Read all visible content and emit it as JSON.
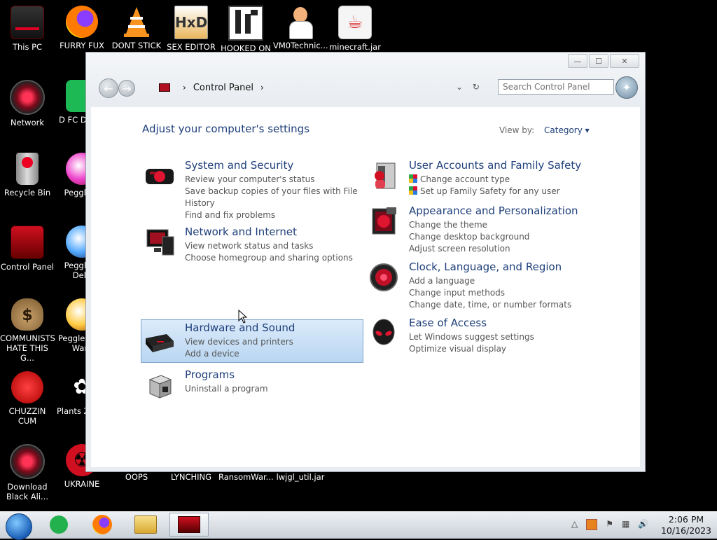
{
  "desktop": {
    "icons": [
      {
        "label": "This PC"
      },
      {
        "label": "FURRY FUX"
      },
      {
        "label": "DONT STICK"
      },
      {
        "label": "SEX EDITOR"
      },
      {
        "label": "HOOKED ON"
      },
      {
        "label": "VM0Technic..."
      },
      {
        "label": "minecraft.jar"
      },
      {
        "label": "Network"
      },
      {
        "label": "D FC DUMB"
      },
      {
        "label": "Recycle Bin"
      },
      {
        "label": "Peggle D"
      },
      {
        "label": "Control Panel"
      },
      {
        "label": "Peggle N Delu"
      },
      {
        "label": "COMMUNISTS HATE THIS G..."
      },
      {
        "label": "Peggle W of Warc"
      },
      {
        "label": "CHUZZIN CUM"
      },
      {
        "label": "Plants Zomb"
      },
      {
        "label": "Download Black Ali..."
      },
      {
        "label": "UKRAINE"
      },
      {
        "label": "OOPS"
      },
      {
        "label": "LYNCHING"
      },
      {
        "label": "RansomWar..."
      },
      {
        "label": "lwjgl_util.jar"
      }
    ]
  },
  "window": {
    "buttons": {
      "minimize": "—",
      "maximize": "☐",
      "close": "✕"
    },
    "nav": {
      "back": "←",
      "forward": "→"
    },
    "breadcrumb": {
      "sep1": "›",
      "item": "Control Panel",
      "sep2": "›"
    },
    "addr_tools": {
      "dropdown": "⌄",
      "refresh": "↻"
    },
    "search": {
      "placeholder": "Search Control Panel",
      "button": "✦"
    },
    "heading": "Adjust your computer's settings",
    "view_by": {
      "label": "View by:",
      "value": "Category ▾"
    },
    "categories": [
      {
        "title": "System and Security",
        "links": [
          "Review your computer's status",
          "Save backup copies of your files with File History",
          "Find and fix problems"
        ]
      },
      {
        "title": "Network and Internet",
        "links": [
          "View network status and tasks",
          "Choose homegroup and sharing options"
        ]
      },
      {
        "title": "Hardware and Sound",
        "links": [
          "View devices and printers",
          "Add a device"
        ]
      },
      {
        "title": "Programs",
        "links": [
          "Uninstall a program"
        ]
      },
      {
        "title": "User Accounts and Family Safety",
        "links": [
          "Change account type",
          "Set up Family Safety for any user"
        ]
      },
      {
        "title": "Appearance and Personalization",
        "links": [
          "Change the theme",
          "Change desktop background",
          "Adjust screen resolution"
        ]
      },
      {
        "title": "Clock, Language, and Region",
        "links": [
          "Add a language",
          "Change input methods",
          "Change date, time, or number formats"
        ]
      },
      {
        "title": "Ease of Access",
        "links": [
          "Let Windows suggest settings",
          "Optimize visual display"
        ]
      }
    ]
  },
  "taskbar": {
    "tray": {
      "show_hidden": "△",
      "flag": "⚑",
      "network": "▦",
      "volume": "🔊"
    },
    "clock": {
      "time": "2:06 PM",
      "date": "10/16/2023"
    }
  },
  "colors": {
    "link_blue": "#1e3f7a",
    "hover_fill": "#b9d6f2",
    "taskbar": "#c9d0d7"
  }
}
